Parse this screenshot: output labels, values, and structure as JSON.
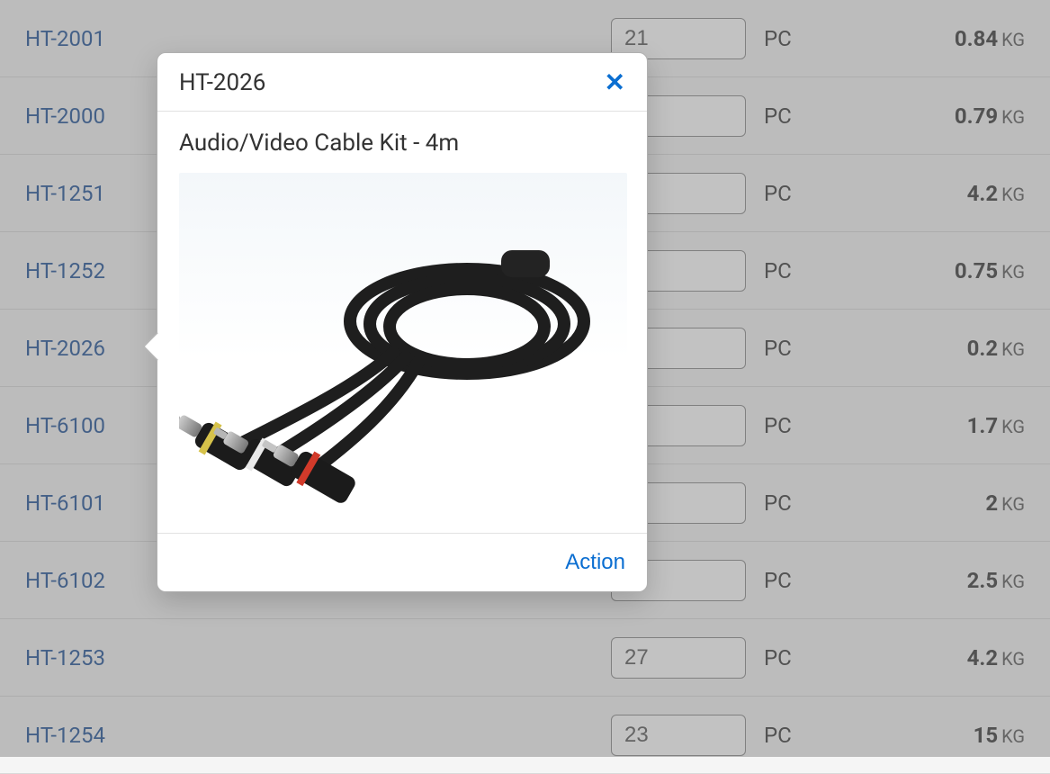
{
  "unit_label": "PC",
  "weight_unit": "KG",
  "rows": [
    {
      "id": "HT-2001",
      "qty": "21",
      "weight": "0.84"
    },
    {
      "id": "HT-2000",
      "qty": "",
      "weight": "0.79"
    },
    {
      "id": "HT-1251",
      "qty": "",
      "weight": "4.2"
    },
    {
      "id": "HT-1252",
      "qty": "",
      "weight": "0.75"
    },
    {
      "id": "HT-2026",
      "qty": "",
      "weight": "0.2"
    },
    {
      "id": "HT-6100",
      "qty": "",
      "weight": "1.7"
    },
    {
      "id": "HT-6101",
      "qty": "",
      "weight": "2"
    },
    {
      "id": "HT-6102",
      "qty": "",
      "weight": "2.5"
    },
    {
      "id": "HT-1253",
      "qty": "27",
      "weight": "4.2"
    },
    {
      "id": "HT-1254",
      "qty": "23",
      "weight": "15"
    }
  ],
  "popover": {
    "title": "HT-2026",
    "product_name": "Audio/Video Cable Kit - 4m",
    "action_label": "Action",
    "image_alt": "audio-video-cable-kit"
  }
}
